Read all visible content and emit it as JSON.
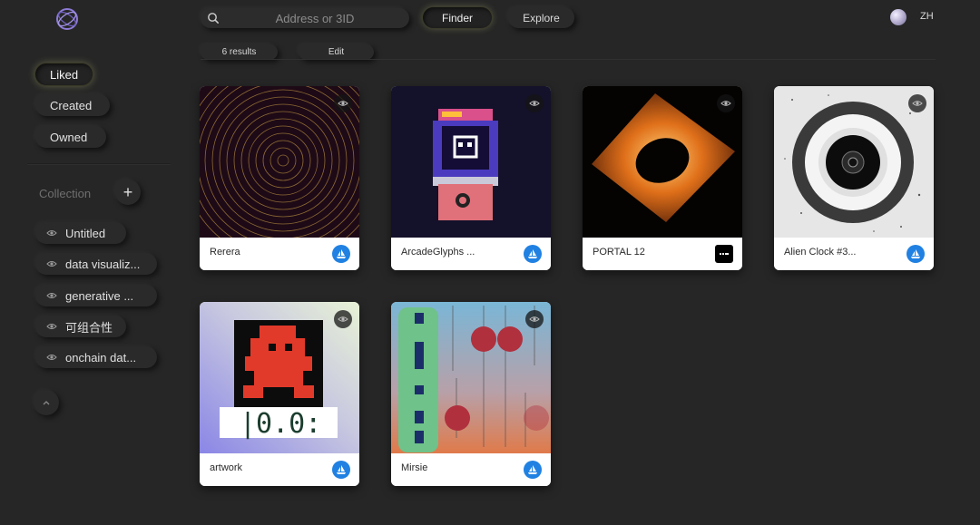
{
  "header": {
    "search_placeholder": "Address or 3ID",
    "nav": [
      "Finder",
      "Explore"
    ],
    "active_nav": "Finder",
    "language": "ZH"
  },
  "toolbar": {
    "results_label": "6 results",
    "edit_label": "Edit"
  },
  "sidebar": {
    "filters": [
      {
        "label": "Liked",
        "active": true
      },
      {
        "label": "Created",
        "active": false
      },
      {
        "label": "Owned",
        "active": false
      }
    ],
    "collection_label": "Collection",
    "add_icon": "plus-icon",
    "collections": [
      {
        "label": "Untitled"
      },
      {
        "label": "data visualiz..."
      },
      {
        "label": "generative ..."
      },
      {
        "label": "可组合性"
      },
      {
        "label": "onchain dat..."
      }
    ],
    "collapse_icon": "chevron-up-icon"
  },
  "grid": {
    "cards": [
      {
        "name": "Rerera",
        "market": "opensea-icon"
      },
      {
        "name": "ArcadeGlyphs ...",
        "market": "opensea-icon"
      },
      {
        "name": "PORTAL 12",
        "market": "dark-market-icon"
      },
      {
        "name": "Alien Clock #3...",
        "market": "opensea-icon"
      },
      {
        "name": "artwork",
        "market": "opensea-icon"
      },
      {
        "name": "Mirsie",
        "market": "opensea-icon"
      }
    ]
  },
  "colors": {
    "background": "#262626",
    "accent_glow": "#dcdc8c",
    "opensea_blue": "#2081e2"
  }
}
